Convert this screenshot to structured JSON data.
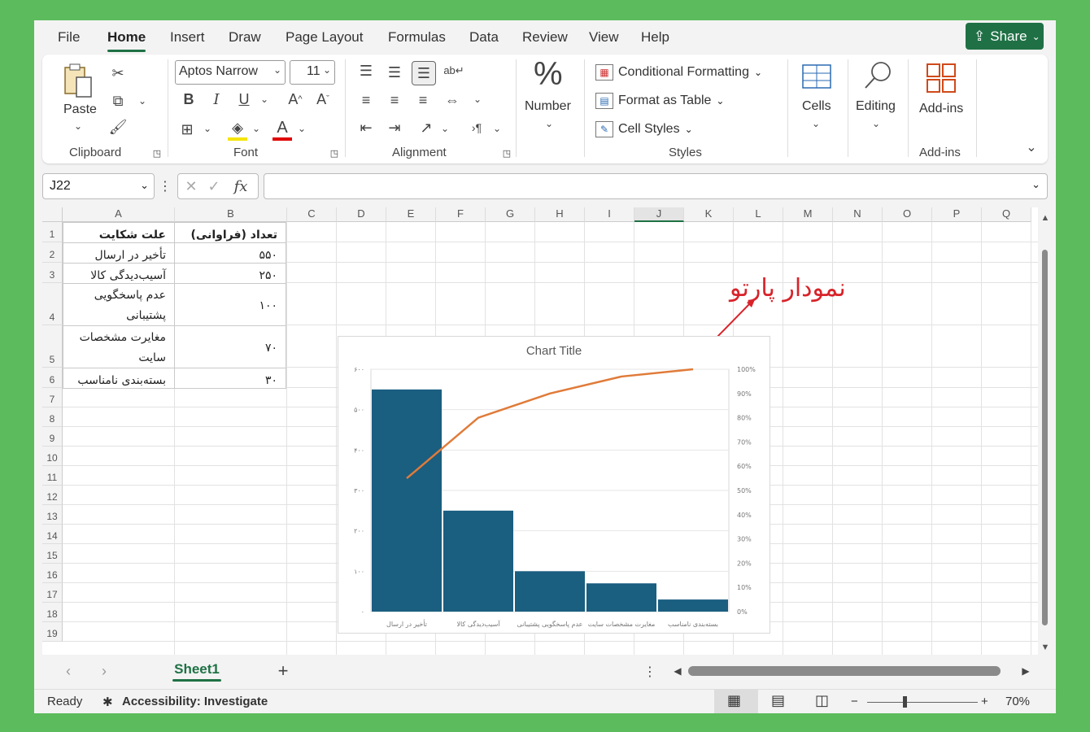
{
  "menu": {
    "tabs": [
      "File",
      "Home",
      "Insert",
      "Draw",
      "Page Layout",
      "Formulas",
      "Data",
      "Review",
      "View",
      "Help"
    ],
    "active": "Home",
    "share_label": "Share"
  },
  "ribbon": {
    "paste_label": "Paste",
    "clipboard_label": "Clipboard",
    "font_name": "Aptos Narrow",
    "font_size": "11",
    "font_label": "Font",
    "alignment_label": "Alignment",
    "number_label": "Number",
    "number_icon": "%",
    "conditional_formatting_label": "Conditional Formatting",
    "format_as_table_label": "Format as Table",
    "cell_styles_label": "Cell Styles",
    "styles_label": "Styles",
    "cells_label": "Cells",
    "editing_label": "Editing",
    "addins_button_label": "Add-ins",
    "addins_group_label": "Add-ins"
  },
  "formula_bar": {
    "name_box": "J22",
    "formula": "",
    "fx": "fx"
  },
  "grid": {
    "columns": [
      "A",
      "B",
      "C",
      "D",
      "E",
      "F",
      "G",
      "H",
      "I",
      "J",
      "K",
      "L",
      "M",
      "N",
      "O",
      "P",
      "Q"
    ],
    "selected_column": "J",
    "rows": [
      "1",
      "2",
      "3",
      "4",
      "5",
      "6",
      "7",
      "8",
      "9",
      "10",
      "11",
      "12",
      "13",
      "14",
      "15",
      "16",
      "17",
      "18",
      "19"
    ],
    "cells": {
      "a1": "علت شکایت",
      "b1": "تعداد (فراوانی)",
      "a2": "تأخیر در ارسال",
      "b2": "۵۵۰",
      "a3": "آسیب‌دیدگی کالا",
      "b3": "۲۵۰",
      "a4": "عدم پاسخگویی پشتیبانی",
      "b4": "۱۰۰",
      "a5": "مغایرت مشخصات سایت",
      "b5": "۷۰",
      "a6": "بسته‌بندی نامناسب",
      "b6": "۳۰"
    }
  },
  "annotation": "نمودار پارتو",
  "chart_data": {
    "type": "bar",
    "title": "Chart Title",
    "categories": [
      "تأخیر در ارسال",
      "آسیب‌دیدگی کالا",
      "عدم پاسخگویی پشتیبانی",
      "مغایرت مشخصات سایت",
      "بسته‌بندی نامناسب"
    ],
    "values": [
      550,
      250,
      100,
      70,
      30
    ],
    "cumulative_pct": [
      55,
      80,
      90,
      97,
      100
    ],
    "ylim": [
      0,
      600
    ],
    "y_ticks": [
      "۰",
      "۱۰۰",
      "۲۰۰",
      "۳۰۰",
      "۴۰۰",
      "۵۰۰",
      "۶۰۰"
    ],
    "y2_ticks": [
      "0%",
      "10%",
      "20%",
      "30%",
      "40%",
      "50%",
      "60%",
      "70%",
      "80%",
      "90%",
      "100%"
    ],
    "bar_color": "#1a5e80",
    "line_color": "#e07b39",
    "grid": true
  },
  "sheet": {
    "tab": "Sheet1",
    "add": "+"
  },
  "status": {
    "ready": "Ready",
    "accessibility": "Accessibility: Investigate",
    "zoom": "70%"
  }
}
